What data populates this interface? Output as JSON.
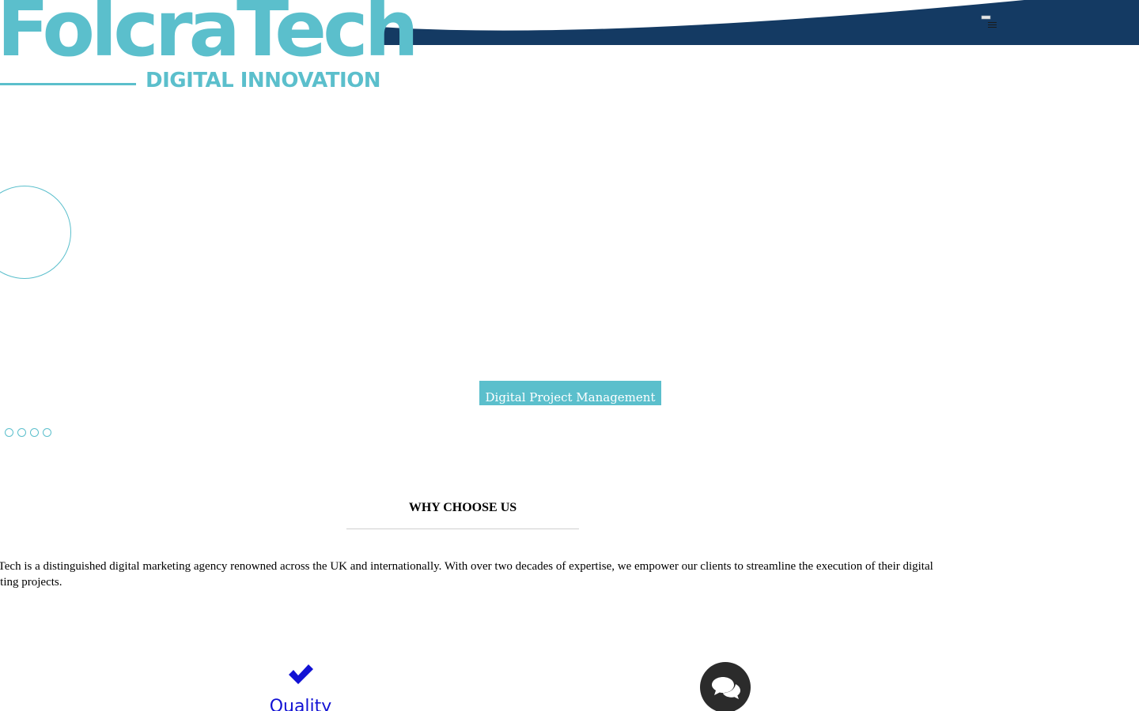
{
  "brand": {
    "name": "FolcraTech",
    "tagline": "DIGITAL INNOVATION"
  },
  "header": {
    "menu_icon": "hamburger-icon"
  },
  "hero": {
    "cta_label": "Digital Project Management",
    "slide_count": 4
  },
  "why_choose_us": {
    "title": "WHY CHOOSE US",
    "intro": "raTech is a distinguished digital marketing agency renowned across the UK and internationally. With over two decades of expertise, we empower our clients to streamline the execution of their digital keting projects."
  },
  "features": [
    {
      "icon": "check-icon",
      "label": "Quality"
    }
  ],
  "chat": {
    "icon": "chat-bubbles-icon"
  },
  "colors": {
    "navy": "#143a63",
    "teal": "#5bbfcc",
    "feature_blue": "#1212d4",
    "chat_bg": "#2b2b2b"
  }
}
